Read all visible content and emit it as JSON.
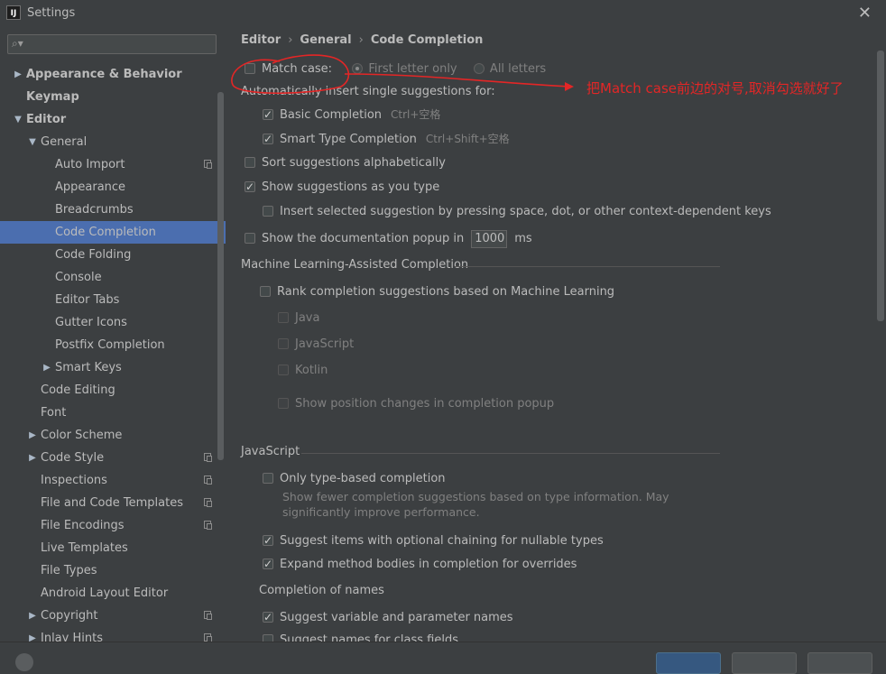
{
  "window": {
    "title": "Settings",
    "app_icon": "IJ"
  },
  "sidebar": {
    "search_placeholder": "",
    "items": [
      {
        "label": "Appearance & Behavior",
        "level": 0,
        "bold": true,
        "arrow": "right"
      },
      {
        "label": "Keymap",
        "level": 0,
        "bold": true,
        "arrow": ""
      },
      {
        "label": "Editor",
        "level": 0,
        "bold": true,
        "arrow": "down"
      },
      {
        "label": "General",
        "level": 1,
        "arrow": "down"
      },
      {
        "label": "Auto Import",
        "level": 2,
        "copy": true
      },
      {
        "label": "Appearance",
        "level": 2
      },
      {
        "label": "Breadcrumbs",
        "level": 2
      },
      {
        "label": "Code Completion",
        "level": 2,
        "selected": true
      },
      {
        "label": "Code Folding",
        "level": 2
      },
      {
        "label": "Console",
        "level": 2
      },
      {
        "label": "Editor Tabs",
        "level": 2
      },
      {
        "label": "Gutter Icons",
        "level": 2
      },
      {
        "label": "Postfix Completion",
        "level": 2
      },
      {
        "label": "Smart Keys",
        "level": 2,
        "arrow": "right"
      },
      {
        "label": "Code Editing",
        "level": 1
      },
      {
        "label": "Font",
        "level": 1
      },
      {
        "label": "Color Scheme",
        "level": 1,
        "arrow": "right"
      },
      {
        "label": "Code Style",
        "level": 1,
        "arrow": "right",
        "copy": true
      },
      {
        "label": "Inspections",
        "level": 1,
        "copy": true
      },
      {
        "label": "File and Code Templates",
        "level": 1,
        "copy": true
      },
      {
        "label": "File Encodings",
        "level": 1,
        "copy": true
      },
      {
        "label": "Live Templates",
        "level": 1
      },
      {
        "label": "File Types",
        "level": 1
      },
      {
        "label": "Android Layout Editor",
        "level": 1
      },
      {
        "label": "Copyright",
        "level": 1,
        "arrow": "right",
        "copy": true
      },
      {
        "label": "Inlay Hints",
        "level": 1,
        "arrow": "right",
        "copy": true
      }
    ]
  },
  "breadcrumb": [
    "Editor",
    "General",
    "Code Completion"
  ],
  "options": {
    "match_case": "Match case:",
    "first_letter_only": "First letter only",
    "all_letters": "All letters",
    "auto_insert_header": "Automatically insert single suggestions for:",
    "basic_completion": "Basic Completion",
    "basic_shortcut": "Ctrl+空格",
    "smart_completion": "Smart Type Completion",
    "smart_shortcut": "Ctrl+Shift+空格",
    "sort_alpha": "Sort suggestions alphabetically",
    "show_as_type": "Show suggestions as you type",
    "insert_selected": "Insert selected suggestion by pressing space, dot, or other context-dependent keys",
    "show_doc_popup": "Show the documentation popup in",
    "doc_popup_value": "1000",
    "doc_popup_unit": "ms"
  },
  "ml": {
    "header": "Machine Learning-Assisted Completion",
    "rank": "Rank completion suggestions based on Machine Learning",
    "java": "Java",
    "javascript": "JavaScript",
    "kotlin": "Kotlin",
    "position_changes": "Show position changes in completion popup"
  },
  "js": {
    "header": "JavaScript",
    "only_type_based": "Only type-based completion",
    "only_type_desc_1": "Show fewer completion suggestions based on type information. May",
    "only_type_desc_2": "significantly improve performance.",
    "optional_chaining": "Suggest items with optional chaining for nullable types",
    "expand_bodies": "Expand method bodies in completion for overrides",
    "names_header": "Completion of names",
    "suggest_var_names": "Suggest variable and parameter names",
    "suggest_class_fields": "Suggest names for class fields"
  },
  "annotation": {
    "text": "把Match case前边的对号,取消勾选就好了",
    "color": "#e32626"
  },
  "colors": {
    "background": "#3c3f41",
    "selection": "#4b6eaf",
    "text": "#bbbbbb",
    "annotation": "#e32626"
  }
}
